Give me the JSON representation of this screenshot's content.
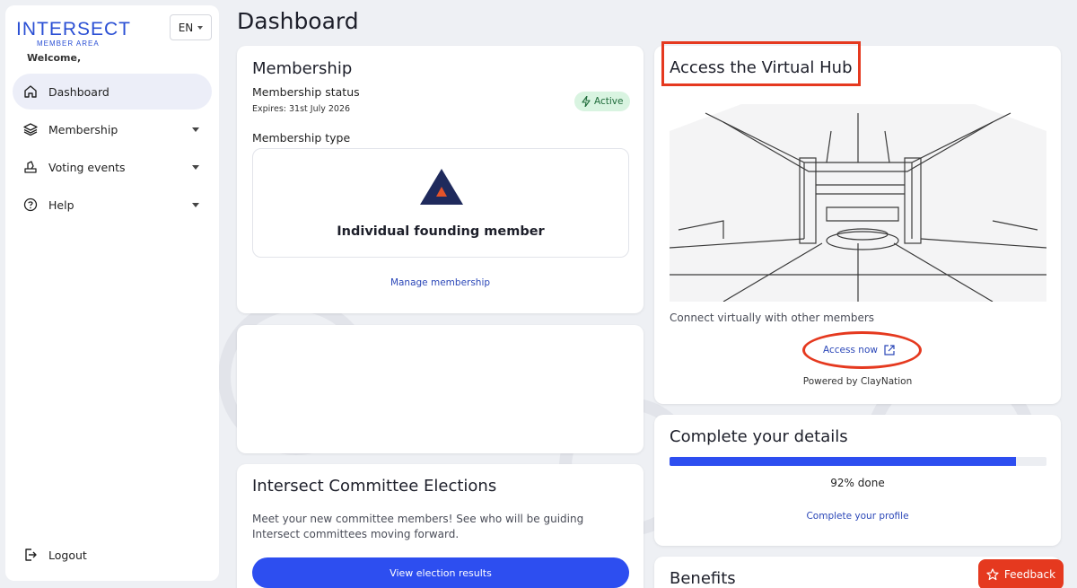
{
  "app": {
    "logo_word": "INTERSECT",
    "logo_sub": "MEMBER AREA",
    "language": "EN",
    "welcome": "Welcome,"
  },
  "sidebar": {
    "items": [
      {
        "label": "Dashboard",
        "icon": "home-icon",
        "active": true
      },
      {
        "label": "Membership",
        "icon": "layers-icon",
        "has_dropdown": true
      },
      {
        "label": "Voting events",
        "icon": "vote-icon",
        "has_dropdown": true
      },
      {
        "label": "Help",
        "icon": "help-circle-icon",
        "has_dropdown": true
      }
    ],
    "logout_label": "Logout"
  },
  "page": {
    "title": "Dashboard"
  },
  "membership_card": {
    "title": "Membership",
    "status_label": "Membership status",
    "expires": "Expires: 31st July 2026",
    "status_badge": "Active",
    "type_label": "Membership type",
    "tier_name": "Individual founding member",
    "manage_link": "Manage membership"
  },
  "elections_card": {
    "title": "Intersect Committee Elections",
    "description": "Meet your new committee members! See who will be guiding Intersect committees moving forward.",
    "button": "View election results"
  },
  "hub_card": {
    "title": "Access the Virtual Hub",
    "description": "Connect virtually with other members",
    "access_link": "Access now",
    "powered_by": "Powered by ClayNation"
  },
  "details_card": {
    "title": "Complete your details",
    "progress_percent": 92,
    "progress_text": "92% done",
    "link": "Complete your profile"
  },
  "benefits_card": {
    "title": "Benefits"
  },
  "feedback_button": "Feedback",
  "colors": {
    "accent": "#2d4ef0",
    "link": "#2b47b8",
    "annotation": "#e5391f",
    "active_badge_bg": "#d9f4e1",
    "brand_blue": "#2a4fd4",
    "tier_navy": "#1f2a5c",
    "tier_orange": "#e5532a"
  }
}
